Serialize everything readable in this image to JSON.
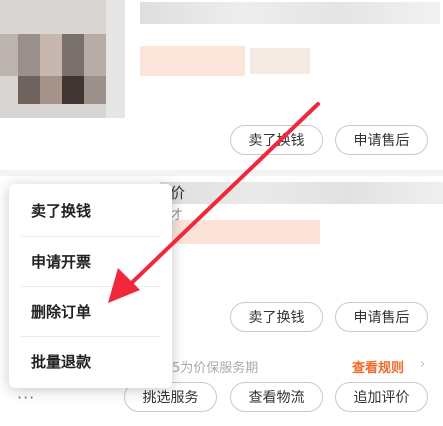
{
  "order1": {
    "buttons": {
      "sell": "卖了换钱",
      "after_sale": "申请售后"
    }
  },
  "order2": {
    "title_fragment": "价",
    "subtitle_fragment": "才",
    "buttons": {
      "sell": "卖了换钱",
      "after_sale": "申请售后"
    }
  },
  "notice": {
    "text": "5为价保服务期",
    "link": "查看规则",
    "chevron": "›"
  },
  "bottom_bar": {
    "more_icon": "more-dots-icon",
    "more_glyph": "···",
    "select_service": "挑选服务",
    "view_logistics": "查看物流",
    "add_review": "追加评价"
  },
  "popup_menu": {
    "items": [
      {
        "label": "卖了换钱"
      },
      {
        "label": "申请开票"
      },
      {
        "label": "删除订单"
      },
      {
        "label": "批量退款"
      }
    ]
  },
  "annotation": {
    "color": "#f0283c"
  },
  "colors": {
    "accent": "#f06a2a",
    "button_border": "#c9c9c9",
    "text": "#333333"
  }
}
